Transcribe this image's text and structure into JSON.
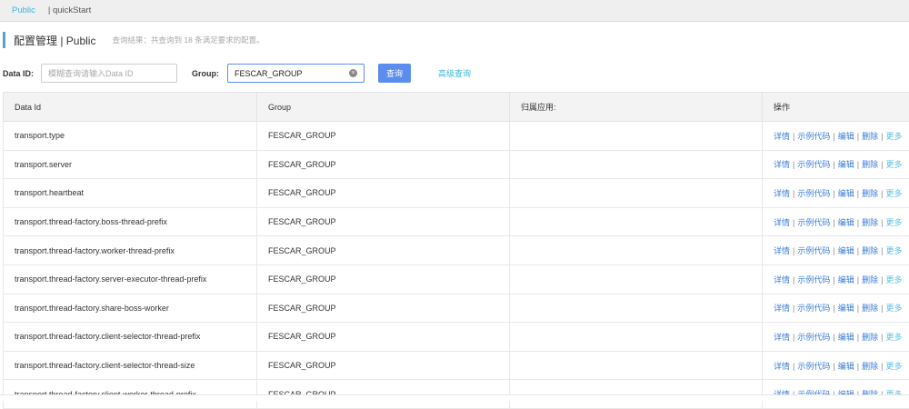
{
  "topbar": {
    "active": "Public",
    "other": "| quickStart"
  },
  "title": {
    "main": "配置管理 | Public",
    "hint": "查询结果：共查询到 18 条满足要求的配置。"
  },
  "search": {
    "data_id_label": "Data ID:",
    "data_id_placeholder": "模糊查询请输入Data ID",
    "group_label": "Group:",
    "group_value": "FESCAR_GROUP",
    "query_button": "查询",
    "advanced_link": "高级查询"
  },
  "table": {
    "headers": [
      "Data Id",
      "Group",
      "归属应用:",
      "操作"
    ],
    "actions": [
      "详情",
      "示例代码",
      "编辑",
      "删除",
      "更多"
    ],
    "rows": [
      [
        "transport.type",
        "FESCAR_GROUP",
        ""
      ],
      [
        "transport.server",
        "FESCAR_GROUP",
        ""
      ],
      [
        "transport.heartbeat",
        "FESCAR_GROUP",
        ""
      ],
      [
        "transport.thread-factory.boss-thread-prefix",
        "FESCAR_GROUP",
        ""
      ],
      [
        "transport.thread-factory.worker-thread-prefix",
        "FESCAR_GROUP",
        ""
      ],
      [
        "transport.thread-factory.server-executor-thread-prefix",
        "FESCAR_GROUP",
        ""
      ],
      [
        "transport.thread-factory.share-boss-worker",
        "FESCAR_GROUP",
        ""
      ],
      [
        "transport.thread-factory.client-selector-thread-prefix",
        "FESCAR_GROUP",
        ""
      ],
      [
        "transport.thread-factory.client-selector-thread-size",
        "FESCAR_GROUP",
        ""
      ],
      [
        "transport.thread-factory.client-worker-thread-prefix",
        "FESCAR_GROUP",
        ""
      ]
    ]
  }
}
